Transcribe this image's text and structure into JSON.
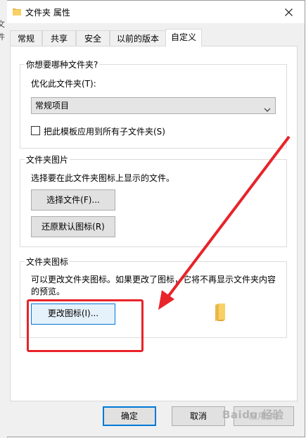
{
  "edge_text": [
    "文",
    "件"
  ],
  "window": {
    "title": "文件夹 属性"
  },
  "tabs": [
    {
      "label": "常规",
      "active": false
    },
    {
      "label": "共享",
      "active": false
    },
    {
      "label": "安全",
      "active": false
    },
    {
      "label": "以前的版本",
      "active": false
    },
    {
      "label": "自定义",
      "active": true
    }
  ],
  "folder_type": {
    "group_label": "你想要哪种文件夹?",
    "optimize_label": "优化此文件夹(T):",
    "select_value": "常规项目",
    "apply_checkbox_label": "把此模板应用到所有子文件夹(S)",
    "apply_checked": false
  },
  "folder_pictures": {
    "group_label": "文件夹图片",
    "description": "选择要在此文件夹图标上显示的文件。",
    "choose_file_button": "选择文件(F)...",
    "restore_default_button": "还原默认图标(R)"
  },
  "folder_icons": {
    "group_label": "文件夹图标",
    "description_line1": "可以更改文件夹图标。如果更改了图标，它将不再显示文件夹内容",
    "description_line2": "的预览。",
    "change_icon_button": "更改图标(I)..."
  },
  "footer": {
    "ok_button": "确定",
    "cancel_button": "取消",
    "apply_button": "应用(A)"
  },
  "watermark": "Baidu 经验",
  "colors": {
    "annotation_red": "#e8232a",
    "accent_blue": "#0078d7",
    "folder_yellow": "#f8d064"
  }
}
